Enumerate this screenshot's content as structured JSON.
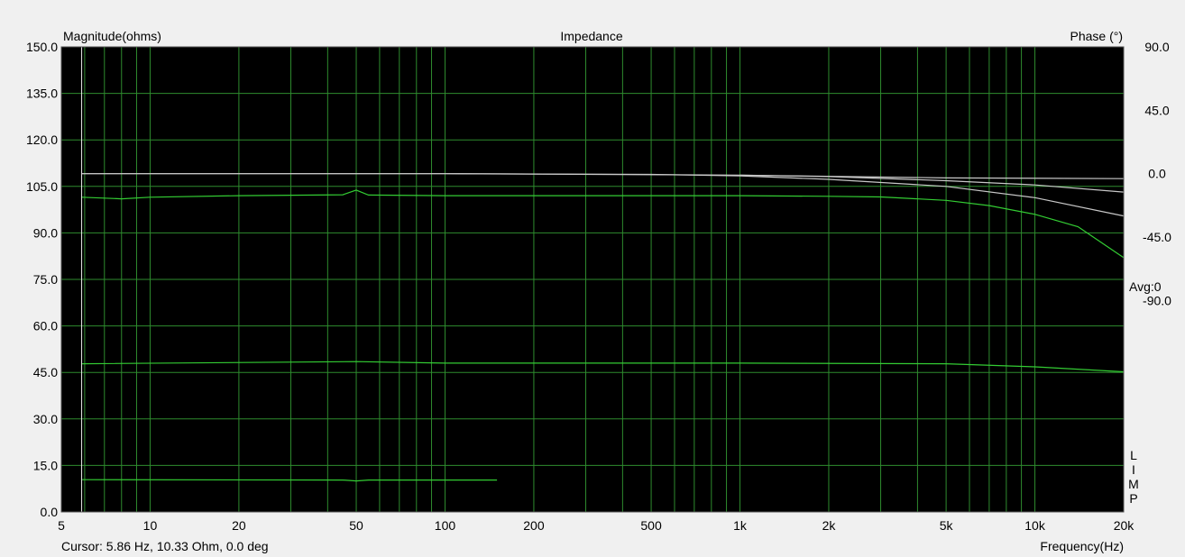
{
  "chart_data": {
    "type": "line",
    "title": "Impedance",
    "ylabel_left": "Magnitude(ohms)",
    "ylabel_right": "Phase (°)",
    "xlabel": "Frequency(Hz)",
    "x_scale": "log",
    "xlim": [
      5,
      20000
    ],
    "ylim_left": [
      0,
      150
    ],
    "ylim_right": [
      -240,
      90
    ],
    "grid": true,
    "background_color": "#000000",
    "grid_color": "#2e8b2e",
    "x_ticks": [
      {
        "value": 5,
        "label": "5"
      },
      {
        "value": 10,
        "label": "10"
      },
      {
        "value": 20,
        "label": "20"
      },
      {
        "value": 50,
        "label": "50"
      },
      {
        "value": 100,
        "label": "100"
      },
      {
        "value": 200,
        "label": "200"
      },
      {
        "value": 500,
        "label": "500"
      },
      {
        "value": 1000,
        "label": "1k"
      },
      {
        "value": 2000,
        "label": "2k"
      },
      {
        "value": 5000,
        "label": "5k"
      },
      {
        "value": 10000,
        "label": "10k"
      },
      {
        "value": 20000,
        "label": "20k"
      }
    ],
    "y_ticks_left": [
      "0.0",
      "15.0",
      "30.0",
      "45.0",
      "60.0",
      "75.0",
      "90.0",
      "105.0",
      "120.0",
      "135.0",
      "150.0"
    ],
    "y_ticks_right": [
      {
        "value": 90,
        "label": "90.0"
      },
      {
        "value": 45,
        "label": "45.0"
      },
      {
        "value": 0,
        "label": "0.0"
      },
      {
        "value": -45,
        "label": "-45.0"
      },
      {
        "value": -90,
        "label": "-90.0"
      }
    ],
    "right_annotations": [
      "Avg:0",
      "L",
      "I",
      "M",
      "P"
    ],
    "cursor": {
      "frequency_hz": 5.86,
      "label": "Cursor: 5.86 Hz, 10.33 Ohm, 0.0 deg"
    },
    "series": [
      {
        "axis": "left",
        "color": "#33cc33",
        "x": [
          5.86,
          8,
          10,
          20,
          45,
          50,
          55,
          100,
          500,
          1000,
          2000,
          3000,
          5000,
          7000,
          10000,
          14000,
          20000
        ],
        "y": [
          101.5,
          101,
          101.5,
          102,
          102.3,
          103.8,
          102.2,
          102,
          102,
          102,
          101.8,
          101.6,
          100.5,
          98.8,
          96,
          92,
          82
        ]
      },
      {
        "axis": "left",
        "color": "#33cc33",
        "x": [
          5.86,
          50,
          100,
          1000,
          5000,
          10000,
          20000
        ],
        "y": [
          47.8,
          48.5,
          48,
          48,
          47.8,
          46.8,
          45.2
        ]
      },
      {
        "axis": "left",
        "color": "#33cc33",
        "x": [
          5.86,
          45,
          50,
          55,
          100,
          150
        ],
        "y": [
          10.4,
          10.3,
          10,
          10.3,
          10.3,
          10.3
        ]
      },
      {
        "axis": "right",
        "color": "#c8c8c8",
        "x": [
          5.86,
          100,
          500,
          1000,
          2000,
          5000,
          10000,
          20000
        ],
        "y": [
          0,
          0,
          -0.5,
          -1.5,
          -4,
          -9,
          -17,
          -30
        ]
      },
      {
        "axis": "right",
        "color": "#c8c8c8",
        "x": [
          5.86,
          100,
          1000,
          2000,
          5000,
          10000,
          20000
        ],
        "y": [
          0,
          0,
          -1,
          -2,
          -5,
          -8,
          -13
        ]
      },
      {
        "axis": "right",
        "color": "#c8c8c8",
        "x": [
          1000,
          5000,
          20000
        ],
        "y": [
          -1,
          -3,
          -3.5
        ]
      }
    ]
  }
}
